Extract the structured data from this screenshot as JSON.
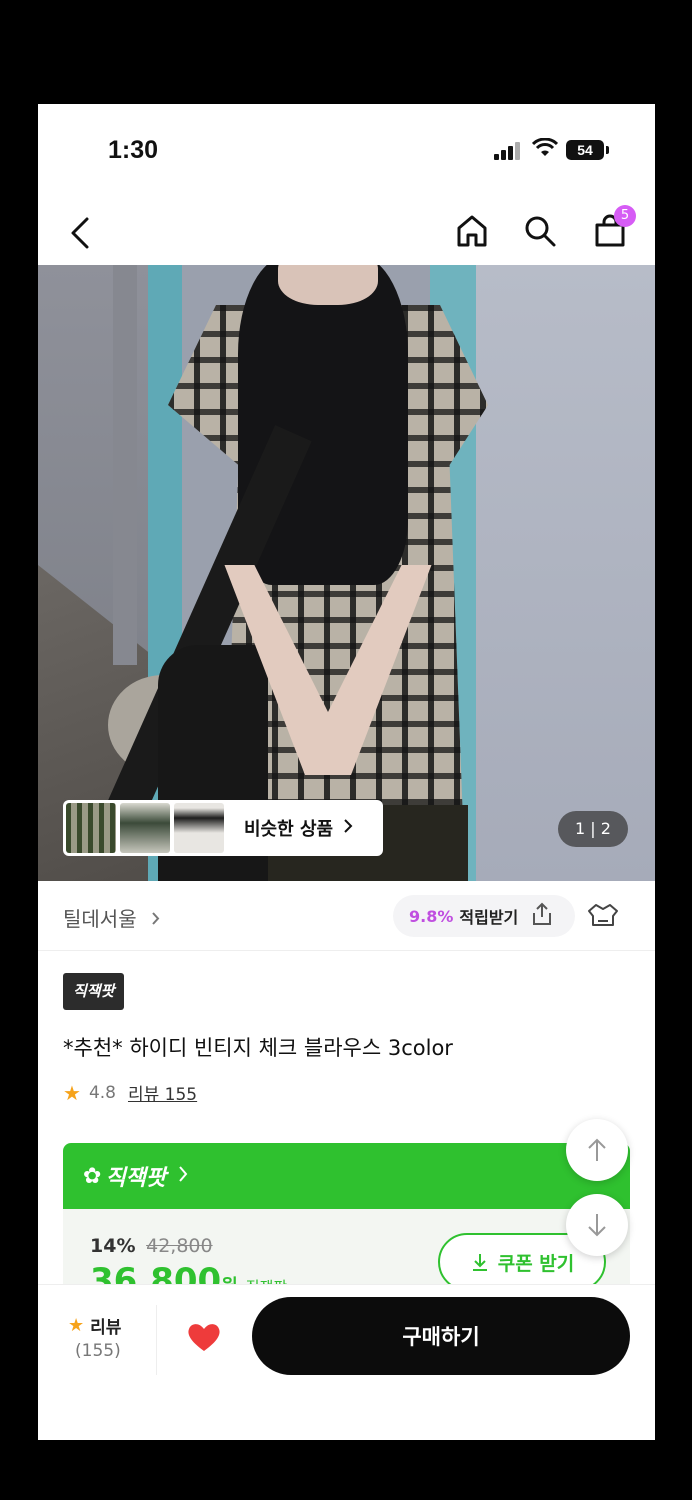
{
  "status": {
    "time": "1:30",
    "battery": "54"
  },
  "nav": {
    "cart_count": "5"
  },
  "hero": {
    "similar_label": "비슷한 상품",
    "page_counter": "1 | 2"
  },
  "brand": {
    "name": "틸데서울",
    "points_pct": "9.8%",
    "points_label": "적립받기"
  },
  "product": {
    "tag": "직잭팟",
    "title": "*추천* 하이디 빈티지 체크 블라우스 3color",
    "rating": "4.8",
    "review_label": "리뷰 155"
  },
  "deal": {
    "badge": "직잭팟",
    "discount": "14%",
    "original_price": "42,800",
    "price": "36,800",
    "price_unit": "원",
    "price_label": "직잭팟",
    "coupon_label": "쿠폰 받기"
  },
  "bottom": {
    "review_label": "리뷰",
    "review_count": "(155)",
    "buy_label": "구매하기"
  },
  "colors": {
    "accent_green": "#2fc12f",
    "points_purple": "#c04fe0",
    "badge_pink": "#d65cf5",
    "heart": "#ee3b3b"
  }
}
